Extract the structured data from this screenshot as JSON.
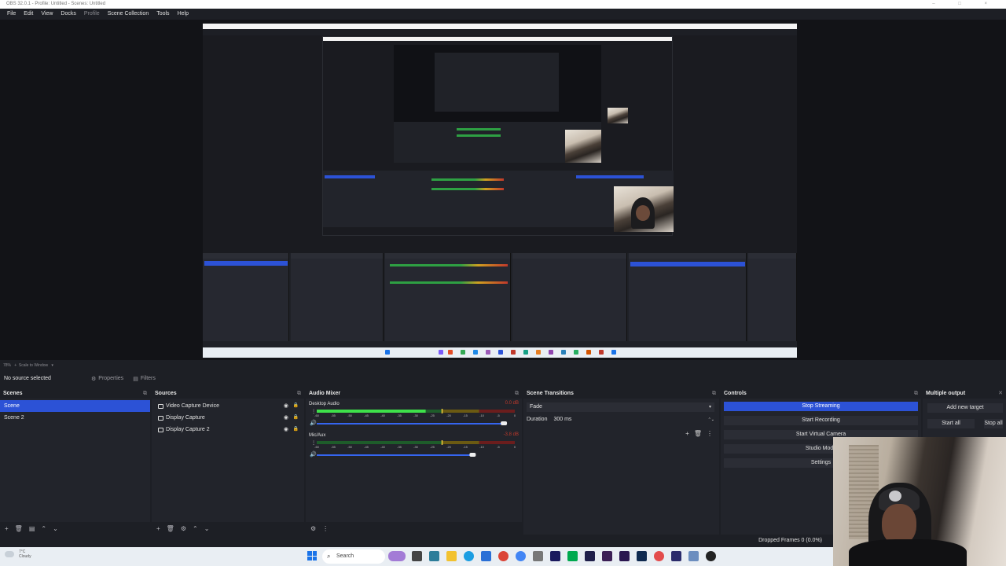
{
  "window": {
    "title": "OBS 32.0.1 - Profile: Untitled - Scenes: Untitled",
    "controls": "– □ ×"
  },
  "menu": [
    "File",
    "Edit",
    "View",
    "Docks",
    "Profile",
    "Scene Collection",
    "Tools",
    "Help"
  ],
  "preview": {
    "zoom": "78%",
    "scale_mode": "Scale to Window"
  },
  "source_toolbar": {
    "no_source": "No source selected",
    "properties": "Properties",
    "filters": "Filters"
  },
  "scenes": {
    "title": "Scenes",
    "items": [
      "Scene",
      "Scene 2"
    ],
    "selected": "Scene"
  },
  "sources": {
    "title": "Sources",
    "items": [
      "Video Capture Device",
      "Display Capture",
      "Display Capture 2"
    ]
  },
  "mixer": {
    "title": "Audio Mixer",
    "channels": [
      {
        "name": "Desktop Audio",
        "db": "0.0 dB",
        "level": 0.55,
        "volume": 0.96
      },
      {
        "name": "Mic/Aux",
        "db": "-3.8 dB",
        "level": 0.0,
        "volume": 0.8
      }
    ],
    "ticks": [
      "-60",
      "-55",
      "-50",
      "-45",
      "-40",
      "-35",
      "-30",
      "-25",
      "-20",
      "-15",
      "-10",
      "-5",
      "0"
    ]
  },
  "transitions": {
    "title": "Scene Transitions",
    "selected": "Fade",
    "duration_label": "Duration",
    "duration_value": "300 ms"
  },
  "controls": {
    "title": "Controls",
    "buttons": [
      "Stop Streaming",
      "Start Recording",
      "Start Virtual Camera",
      "Studio Mode",
      "Settings"
    ]
  },
  "multiple_output": {
    "title": "Multiple output",
    "add_target": "Add new target",
    "start_all": "Start all",
    "stop_all": "Stop all"
  },
  "status": {
    "dropped_frames": "Dropped Frames 0 (0.0%)"
  },
  "taskbar": {
    "temperature": "7°C",
    "condition": "Cloudy",
    "search": "Search"
  },
  "colors": {
    "accent": "#2c52d6",
    "background": "#1d1f25",
    "dock": "#22242b"
  }
}
